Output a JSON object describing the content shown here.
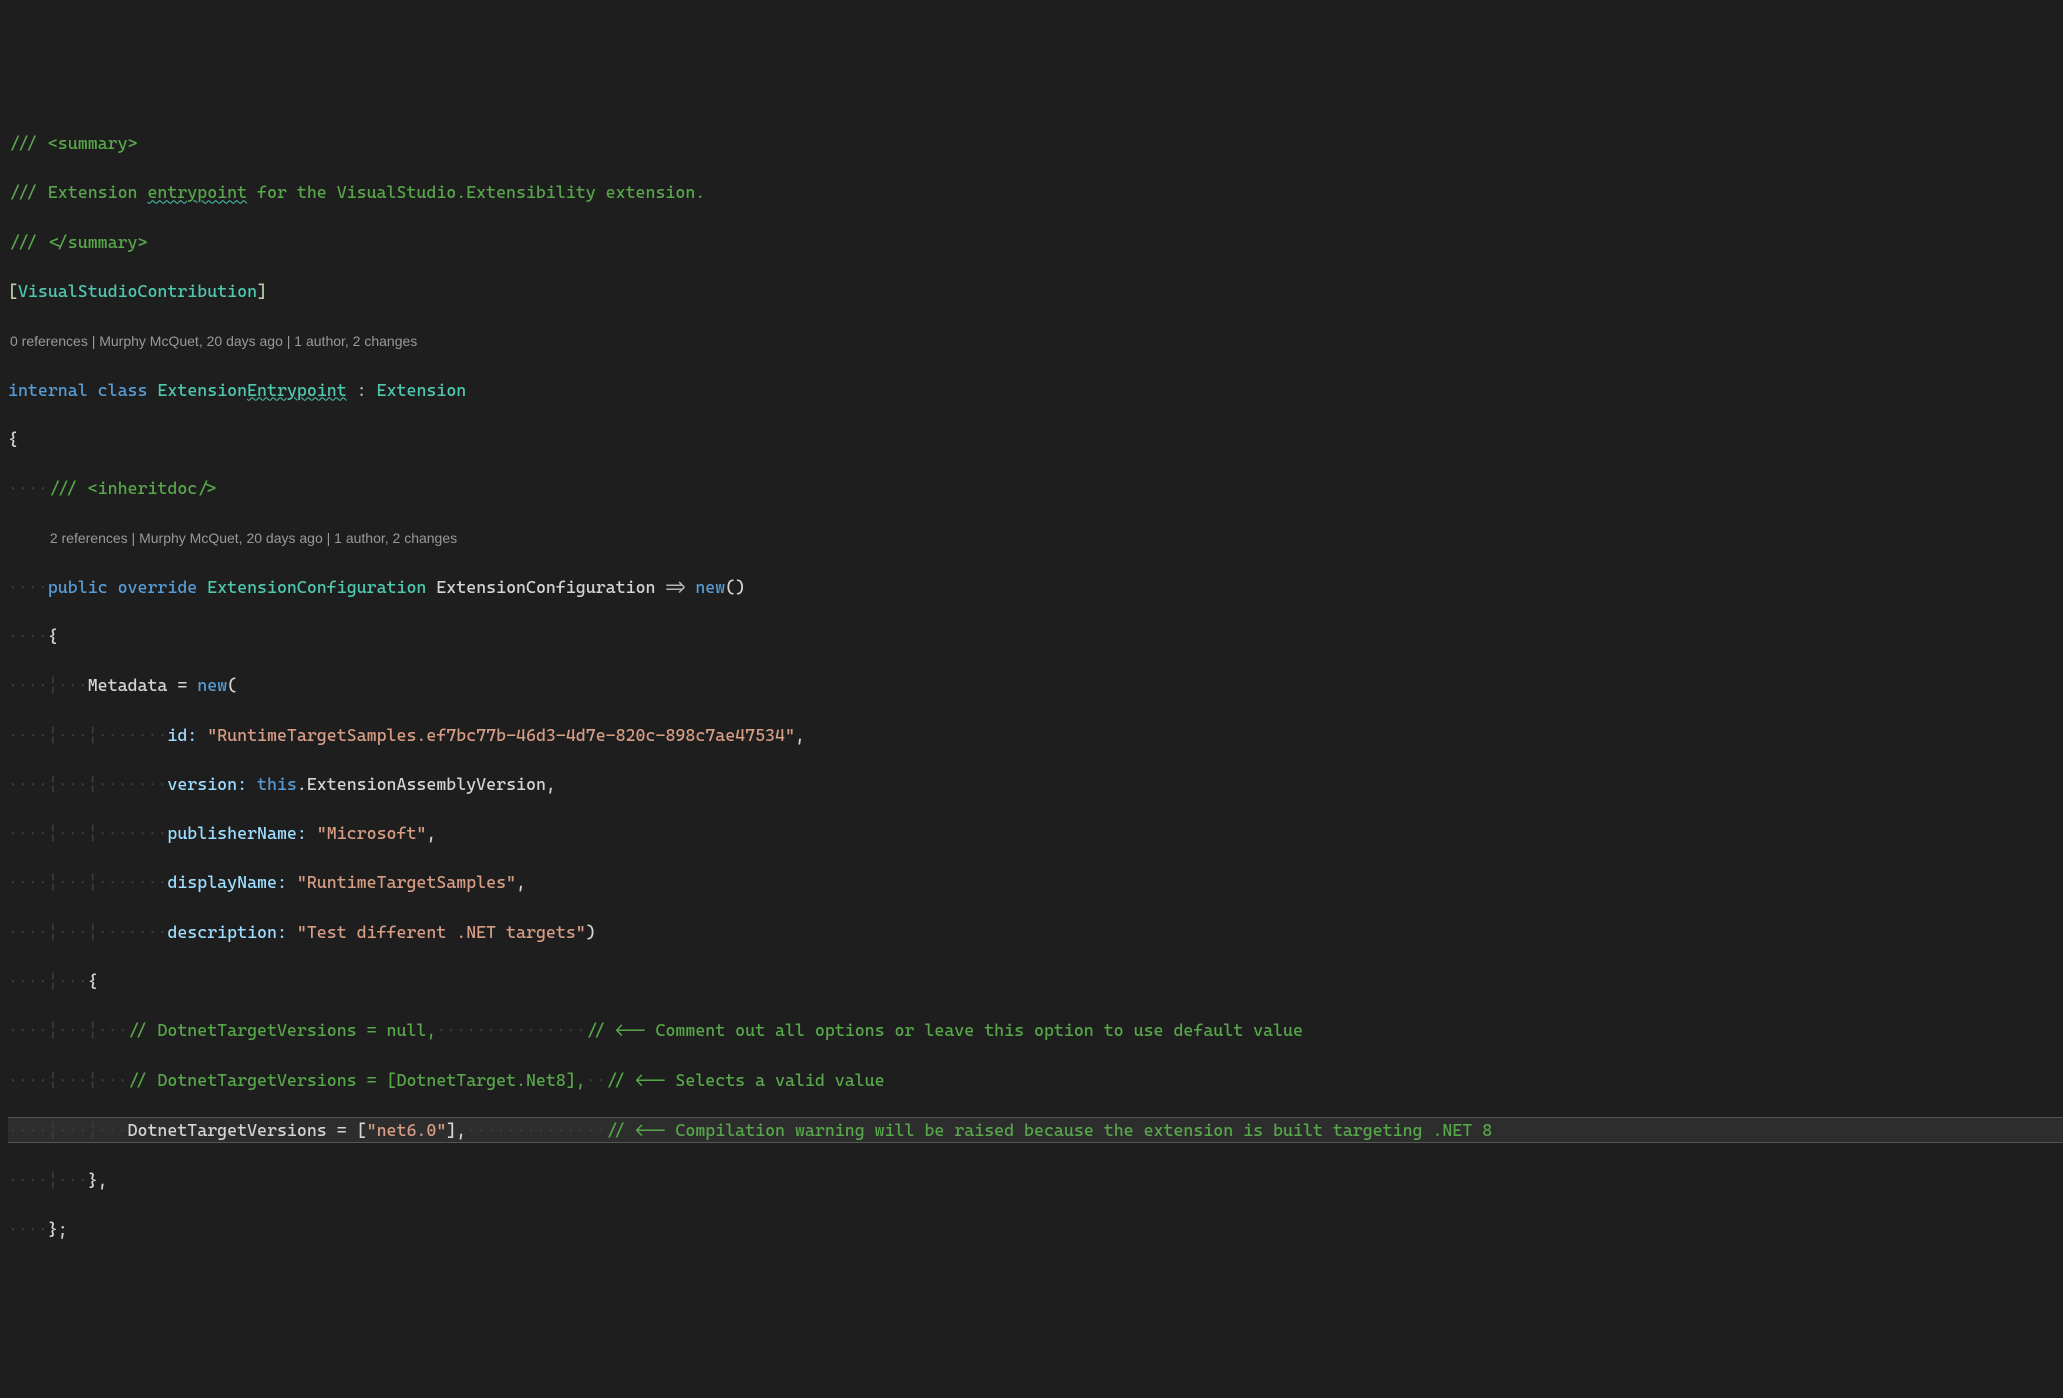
{
  "doc": {
    "sum_open": "/// <summary>",
    "sum_body": "/// Extension entrypoint for the VisualStudio.Extensibility extension.",
    "sum_body_pre": "/// Extension ",
    "sum_body_sq": "entrypoint",
    "sum_body_post": " for the VisualStudio.Extensibility extension.",
    "sum_close": "/// </summary>",
    "inherit": "/// <inheritdoc/>"
  },
  "attr": {
    "name": "VisualStudioContribution"
  },
  "lens1": "0 references | Murphy McQuet, 20 days ago | 1 author, 2 changes",
  "lens2": "2 references | Murphy McQuet, 20 days ago | 1 author, 2 changes",
  "cls": {
    "internal": "internal",
    "class": "class",
    "name_pre": "Extension",
    "name_sq": "Entrypoint",
    "base": "Extension"
  },
  "prop": {
    "public": "public",
    "override": "override",
    "ret": "ExtensionConfiguration",
    "name": "ExtensionConfiguration",
    "lambda": "=>",
    "new": "new",
    "parens": "()"
  },
  "meta": {
    "assign": "Metadata = ",
    "new": "new",
    "open": "(",
    "id_k": "id:",
    "id_v": "\"RuntimeTargetSamples.ef7bc77b-46d3-4d7e-820c-898c7ae47534\"",
    "ver_k": "version: ",
    "ver_this": "this",
    "ver_dot": ".",
    "ver_v": "ExtensionAssemblyVersion",
    "pub_k": "publisherName: ",
    "pub_v": "\"Microsoft\"",
    "disp_k": "displayName: ",
    "disp_v": "\"RuntimeTargetSamples\"",
    "desc_k": "description: ",
    "desc_v": "\"Test different .NET targets\"",
    "close": ")"
  },
  "body": {
    "c1_a": "// DotnetTargetVersions = null,",
    "c1_b": "// <-- Comment out all options or leave this option to use default value",
    "c2_a": "// DotnetTargetVersions = [DotnetTarget.Net8],",
    "c2_b": "// <-- Selects a valid value",
    "c3_prop": "DotnetTargetVersions",
    "c3_eq": " = ",
    "c3_br_o": "[",
    "c3_val": "\"net6.0\"",
    "c3_br_c": "]",
    "c3_comma": ",",
    "c3_cm": "// <-- Compilation warning will be raised because the extension is built targeting .NET 8"
  },
  "ws": {
    "d1": "····",
    "d2": "····¦···",
    "d3": "····¦···¦···",
    "d4": "····¦···¦·······",
    "d5": "····¦···¦···¦···",
    "d3i": "····¦···¦···"
  }
}
